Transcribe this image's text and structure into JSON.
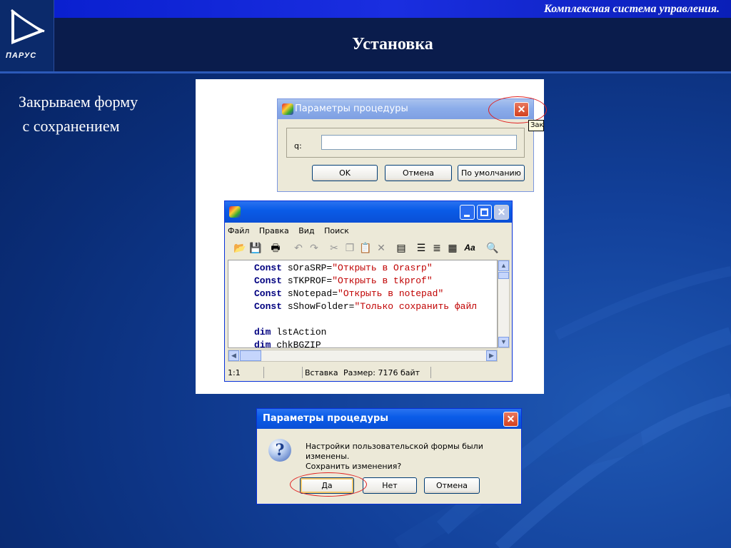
{
  "header": {
    "brand": "Комплексная система управления.",
    "title": "Установка",
    "logo_text": "ПАРУС"
  },
  "side_text": {
    "line1": "Закрываем форму",
    "line2": " с сохранением"
  },
  "params_dialog": {
    "title": "Параметры процедуры",
    "field_label": "q:",
    "field_value": "",
    "ok": "OK",
    "cancel": "Отмена",
    "default": "По умолчанию",
    "tooltip": "Зак"
  },
  "editor": {
    "menu": [
      "Файл",
      "Правка",
      "Вид",
      "Поиск"
    ],
    "code_lines": [
      {
        "kw": "Const",
        "rest": " sOraSRP=",
        "str": "\"Открыть в Orasrp\""
      },
      {
        "kw": "Const",
        "rest": " sTKPROF=",
        "str": "\"Открыть в tkprof\""
      },
      {
        "kw": "Const",
        "rest": " sNotepad=",
        "str": "\"Открыть в notepad\""
      },
      {
        "kw": "Const",
        "rest": " sShowFolder=",
        "str": "\"Только сохранить файл"
      },
      {
        "kw": "",
        "rest": "",
        "str": ""
      },
      {
        "kw": "dim",
        "rest": " lstAction",
        "str": ""
      },
      {
        "kw": "dim",
        "rest": " chkBGZIP",
        "str": ""
      }
    ],
    "status": {
      "pos": "1:1",
      "mode": "Вставка",
      "size": "Размер: 7176 байт"
    }
  },
  "confirm_dialog": {
    "title": "Параметры процедуры",
    "message_line1": "Настройки пользовательской формы были изменены.",
    "message_line2": "Сохранить изменения?",
    "yes": "Да",
    "no": "Нет",
    "cancel": "Отмена"
  },
  "colors": {
    "background": "#0a2f7a",
    "highlight_ellipse": "#e02020",
    "xp_titlebar": "#0a5ce8"
  }
}
